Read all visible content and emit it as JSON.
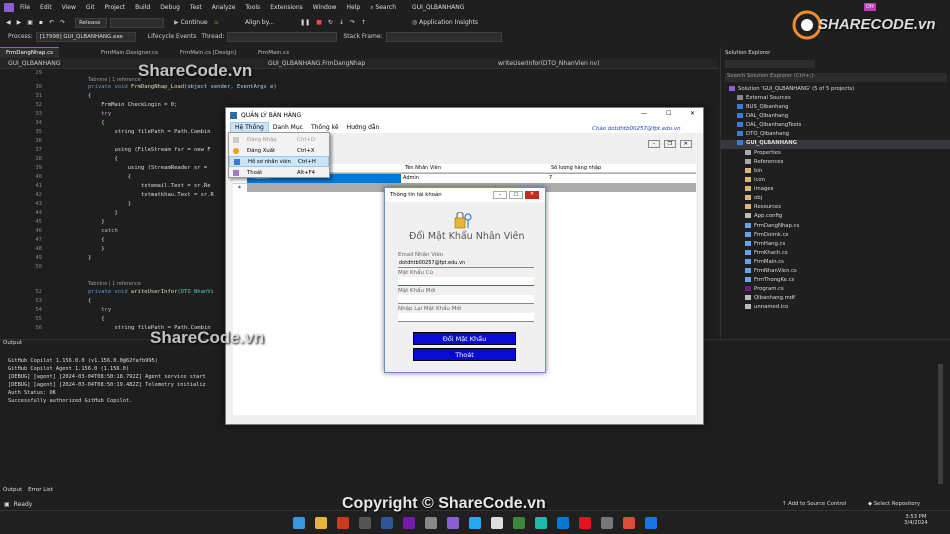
{
  "menubar": {
    "items": [
      "File",
      "Edit",
      "View",
      "Git",
      "Project",
      "Build",
      "Debug",
      "Test",
      "Analyze",
      "Tools",
      "Extensions",
      "Window",
      "Help"
    ],
    "search": "Search",
    "solution_name": "GUI_QLBANHANG",
    "user_initials": "DH"
  },
  "toolbar": {
    "config": "Release",
    "continue": "Continue",
    "align_by": "Align by...",
    "app_insights": "Application Insights"
  },
  "toolbar2": {
    "process_label": "Process:",
    "process_value": "[17998] GUI_QLBANHANG.exe",
    "lifecycle": "Lifecycle Events",
    "thread": "Thread:",
    "stack_frame": "Stack Frame:"
  },
  "doc_tabs": [
    "FrmDangNhap.cs",
    "FrmMain.Designer.cs",
    "FrmMain.cs [Design]",
    "FrmMain.cs"
  ],
  "navbar": {
    "project": "GUI_QLBANHANG",
    "class": "GUI_QLBANHANG.FrmDangNhap",
    "member": "writeUserInfor(DTO_NhanVien nv)"
  },
  "code": {
    "line_numbers": [
      "29",
      "30",
      "31",
      "32",
      "33",
      "34",
      "35",
      "36",
      "37",
      "38",
      "39",
      "40",
      "41",
      "42",
      "43",
      "44",
      "45",
      "46",
      "47",
      "48",
      "49",
      "50",
      "51",
      "52",
      "53",
      "54",
      "55",
      "56",
      "57"
    ],
    "ref1": "Tabnine | 1 reference",
    "l30_kw": "private void ",
    "l30_fn": "FrmDangNhap_Load",
    "l30_rest": "(object sender, EventArgs e)",
    "l31": "{",
    "l32": "    FrmMain CheckLogin = 0;",
    "l33": "    try",
    "l34": "    {",
    "l35": "        string filePath = Path.Combin",
    "l37": "        using (FileStream fsr = new F",
    "l38": "        {",
    "l39": "            using (StreamReader sr =",
    "l40": "            {",
    "l41": "                txtemail.Text = sr.Re",
    "l42": "                txtmatkhau.Text = sr.R",
    "l43": "            }",
    "l44": "        }",
    "l45": "    }",
    "l46": "    catch",
    "l47": "    {",
    "l48": "    }",
    "l49": "}",
    "ref2": "Tabnine | 1 reference",
    "l52_kw": "private void ",
    "l52_fn": "writeUserInfor",
    "l52_rest": "(DTO_NhanVi",
    "l53": "{",
    "l54": "    try",
    "l55": "    {",
    "l56": "        string filePath = Path.Combin"
  },
  "output": {
    "title": "Output",
    "lines": [
      "GitHub Copilot 1.156.0.0 (v1.156.0.0@62fafb995)",
      "GitHub Copilot Agent 1.156.0 (1.156.0)",
      "[DEBUG] [agent] [2024-03-04T08:50:18.792Z] Agent service start",
      "[DEBUG] [agent] [2024-03-04T08:50:19.482Z] Telemetry initializ",
      "Auth Status: OK",
      "Successfully authorized GitHub Copilot."
    ],
    "tabs": [
      "Output",
      "Error List"
    ]
  },
  "statusbar": {
    "ready": "Ready",
    "add_source": "Add to Source Control",
    "select_repo": "Select Repository"
  },
  "taskbar": {
    "time": "3:53 PM",
    "date": "3/4/2024"
  },
  "solution_explorer": {
    "title": "Solution Explorer",
    "search": "Search Solution Explorer (Ctrl+;)",
    "items": [
      "Solution 'GUI_QLBANHANG' (5 of 5 projects)",
      "External Sources",
      "BUS_Qlbanhang",
      "DAL_Qlbanhang",
      "DAL_QlbanhangTests",
      "DTO_Qlbanhang",
      "GUI_QLBANHANG",
      "Properties",
      "References",
      "bin",
      "icon",
      "Images",
      "obj",
      "Resources",
      "App.config",
      "FrmDangNhap.cs",
      "FrmDoimk.cs",
      "FrmHang.cs",
      "FrmKhach.cs",
      "FrmMain.cs",
      "FrmNhanVien.cs",
      "FrmThongKe.cs",
      "Program.cs",
      "Qlbanhang.mdf",
      "unnamed.ico"
    ]
  },
  "app": {
    "title": "QUẢN LÝ BÁN HÀNG",
    "menu": [
      "Hệ Thống",
      "Danh Mục",
      "Thống kê",
      "Hướng dẫn"
    ],
    "greeting": "Chào dotdhtb00257@fpt.edu.vn",
    "dropdown": [
      {
        "label": "Đăng Nhập",
        "shortcut": "Ctrl+D"
      },
      {
        "label": "Đăng Xuất",
        "shortcut": "Ctrl+X"
      },
      {
        "label": "Hồ sơ nhân viên",
        "shortcut": "Ctrl+H"
      },
      {
        "label": "Thoát",
        "shortcut": "Alt+F4"
      }
    ],
    "grid": {
      "headers": [
        "Tên Nhân Viên",
        "Số lượng hàng nhập"
      ],
      "row1": {
        "name": "Admin",
        "qty": "7"
      },
      "row1_sel": "Admin",
      "row2": "*"
    }
  },
  "dialog": {
    "title": "Thông tin tài khoản",
    "heading": "Đổi Mật Khẩu Nhân Viên",
    "email_label": "Email Nhân Viên",
    "email_value": "dotdhtb00257@fpt.edu.vn",
    "old_label": "Mật Khẩu Cũ",
    "new_label": "Mật Khẩu Mới",
    "confirm_label": "Nhập Lại Mật Khẩu Mới",
    "change_btn": "Đổi Mật Khẩu",
    "exit_btn": "Thoát"
  },
  "watermarks": {
    "logo": "SHARECODE.vn",
    "wm1": "ShareCode.vn",
    "wm2": "ShareCode.vn",
    "copyright": "Copyright © ShareCode.vn"
  },
  "colors": {
    "accent": "#8a5fd6",
    "dialog_button": "#0a0ad6"
  }
}
